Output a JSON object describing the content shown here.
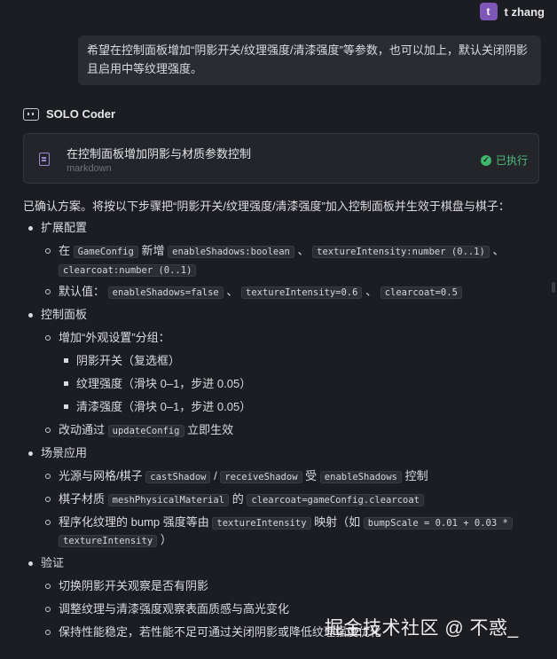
{
  "user": {
    "avatar_letter": "t",
    "name": "t zhang",
    "message": "希望在控制面板增加“阴影开关/纹理强度/清漆强度”等参数，也可以加上，默认关闭阴影且启用中等纹理强度。"
  },
  "agent": {
    "name": "SOLO Coder"
  },
  "task_card": {
    "title": "在控制面板增加阴影与材质参数控制",
    "subtitle": "markdown",
    "status": "已执行",
    "icon": "document-icon"
  },
  "intro": "已确认方案。将按以下步骤把“阴影开关/纹理强度/清漆强度”加入控制面板并生效于棋盘与棋子：",
  "sections": [
    {
      "title": "扩展配置"
    },
    {
      "title": "控制面板"
    },
    {
      "title": "场景应用"
    },
    {
      "title": "验证"
    }
  ],
  "lines": {
    "s1a_1": "在",
    "s1a_c1": "GameConfig",
    "s1a_2": "新增",
    "s1a_c2": "enableShadows:boolean",
    "s1a_3": "、",
    "s1a_c3": "textureIntensity:number (0..1)",
    "s1a_4": "、",
    "s1a_c4": "clearcoat:number (0..1)",
    "s1b_1": "默认值：",
    "s1b_c1": "enableShadows=false",
    "s1b_2": "、",
    "s1b_c2": "textureIntensity=0.6",
    "s1b_3": "、",
    "s1b_c3": "clearcoat=0.5",
    "s2a": "增加“外观设置”分组：",
    "s2a_i1": "阴影开关（复选框）",
    "s2a_i2": "纹理强度（滑块 0–1，步进 0.05）",
    "s2a_i3": "清漆强度（滑块 0–1，步进 0.05）",
    "s2b_1": "改动通过",
    "s2b_c1": "updateConfig",
    "s2b_2": "立即生效",
    "s3a_1": "光源与网格/棋子",
    "s3a_c1": "castShadow",
    "s3a_2": "/",
    "s3a_c2": "receiveShadow",
    "s3a_3": "受",
    "s3a_c3": "enableShadows",
    "s3a_4": "控制",
    "s3b_1": "棋子材质",
    "s3b_c1": "meshPhysicalMaterial",
    "s3b_2": "的",
    "s3b_c2": "clearcoat=gameConfig.clearcoat",
    "s3c_1": "程序化纹理的 bump 强度等由",
    "s3c_c1": "textureIntensity",
    "s3c_2": "映射（如",
    "s3c_c2": "bumpScale = 0.01 + 0.03 *",
    "s3c_c3": "textureIntensity",
    "s3c_3": "）",
    "s4a": "切换阴影开关观察是否有阴影",
    "s4b": "调整纹理与清漆强度观察表面质感与高光变化",
    "s4c": "保持性能稳定，若性能不足可通过关闭阴影或降低纹理强度优化"
  },
  "watermark": "掘金技术社区 @ 不惑_"
}
